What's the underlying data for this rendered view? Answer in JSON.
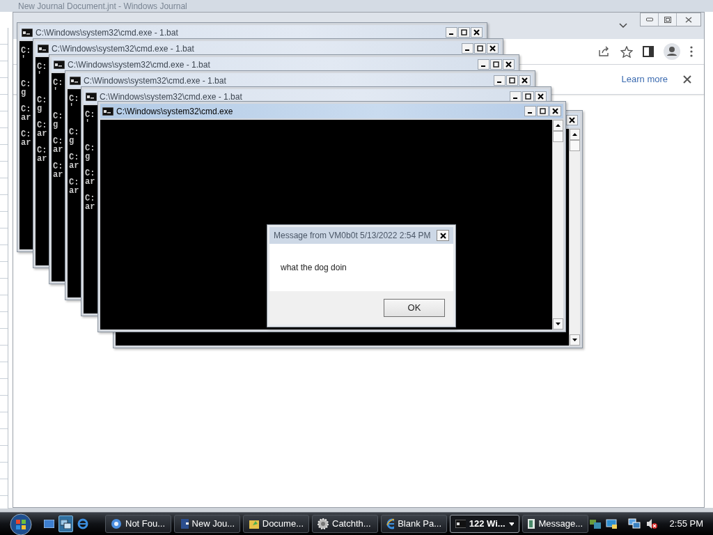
{
  "journal_window": {
    "title": "New Journal Document.jnt - Windows Journal"
  },
  "browser_window": {
    "infobar": {
      "link": "Learn more"
    }
  },
  "console_windows": [
    {
      "kind": "console",
      "active": false,
      "title": "C:\\Windows\\system32\\cmd.exe - 1.bat",
      "text": "C:\n'\n\n\nC:\ng\n\nC:\nar\n\nC:\nar"
    },
    {
      "kind": "console",
      "active": false,
      "title": "C:\\Windows\\system32\\cmd.exe - 1.bat",
      "text": "C:\n'\n\n\nC:\ng\n\nC:\nar\n\nC:\nar"
    },
    {
      "kind": "console",
      "active": false,
      "title": "C:\\Windows\\system32\\cmd.exe - 1.bat",
      "text": "C:\n'\n\n\nC:\ng\n\nC:\nar\n\nC:\nar"
    },
    {
      "kind": "console",
      "active": false,
      "title": "C:\\Windows\\system32\\cmd.exe - 1.bat",
      "text": "C:\n'\n\n\nC:\ng\n\nC:\nar\n\nC:\nar"
    },
    {
      "kind": "console",
      "active": false,
      "title": "C:\\Windows\\system32\\cmd.exe - 1.bat",
      "text": "C:\n'\n\n\nC:\ng\n\nC:\nar\n\nC:\nar"
    },
    {
      "kind": "covered"
    },
    {
      "kind": "console",
      "active": true,
      "title": "C:\\Windows\\system32\\cmd.exe"
    }
  ],
  "message_box": {
    "title": "Message from VM0b0t 5/13/2022 2:54 PM",
    "message": "what the dog doin",
    "buttons": [
      "OK"
    ]
  },
  "taskbar": {
    "quick_launch": [
      {
        "selected": false
      },
      {
        "selected": true
      },
      {
        "selected": false
      }
    ],
    "tasks": [
      {
        "label": "Not Fou...",
        "selected": false,
        "grouped": false
      },
      {
        "label": "New Jou...",
        "selected": false,
        "grouped": false
      },
      {
        "label": "Docume...",
        "selected": false,
        "grouped": false
      },
      {
        "label": "Catchth...",
        "selected": false,
        "grouped": false
      },
      {
        "label": "Blank Pa...",
        "selected": false,
        "grouped": false
      },
      {
        "label": "122 Wi...",
        "selected": true,
        "grouped": true
      },
      {
        "label": "Message...",
        "selected": false,
        "grouped": false
      }
    ],
    "volume_muted": true,
    "clock": "2:55 PM"
  }
}
